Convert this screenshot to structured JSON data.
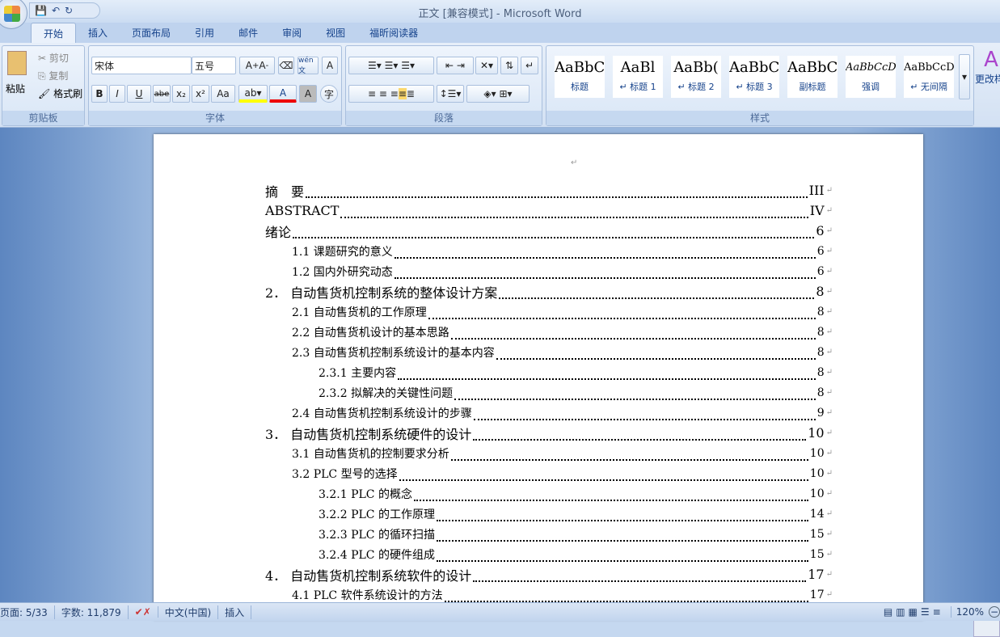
{
  "window": {
    "title": "正文 [兼容模式] - Microsoft Word"
  },
  "tabs": [
    "开始",
    "插入",
    "页面布局",
    "引用",
    "邮件",
    "审阅",
    "视图",
    "福昕阅读器"
  ],
  "clipboard": {
    "label": "剪贴板",
    "paste": "粘贴",
    "cut": "剪切",
    "copy": "复制",
    "format_painter": "格式刷"
  },
  "font": {
    "label": "字体",
    "font_name": "宋体",
    "font_size": "五号",
    "bold": "B",
    "italic": "I",
    "underline": "U",
    "strike": "abe",
    "sub": "x₂",
    "sup": "x²",
    "case": "Aa",
    "grow": "A",
    "shrink": "A",
    "color_letter": "A",
    "charshade": "A",
    "phonetic": "wén文",
    "border": "A",
    "circle": "字"
  },
  "paragraph": {
    "label": "段落"
  },
  "styles": {
    "label": "样式",
    "change": "更改样式",
    "items": [
      {
        "preview": "AaBbC",
        "name": "标题"
      },
      {
        "preview": "AaBl",
        "name": "↵ 标题 1"
      },
      {
        "preview": "AaBb(",
        "name": "↵ 标题 2"
      },
      {
        "preview": "AaBbC",
        "name": "↵ 标题 3"
      },
      {
        "preview": "AaBbC",
        "name": "副标题"
      },
      {
        "preview": "AaBbCcDc",
        "name": "强调"
      },
      {
        "preview": "AaBbCcDc",
        "name": "↵ 无间隔"
      }
    ]
  },
  "toc": [
    {
      "level": 0,
      "text": "摘　要",
      "page": "III"
    },
    {
      "level": 0,
      "text": "ABSTRACT",
      "page": "IV"
    },
    {
      "level": 0,
      "text": "绪论",
      "page": "6"
    },
    {
      "level": 1,
      "text": "1.1  课题研究的意义",
      "page": "6"
    },
    {
      "level": 1,
      "text": "1.2  国内外研究动态",
      "page": "6"
    },
    {
      "level": 0,
      "text": "2．  自动售货机控制系统的整体设计方案",
      "page": "8"
    },
    {
      "level": 1,
      "text": "2.1  自动售货机的工作原理",
      "page": "8"
    },
    {
      "level": 1,
      "text": "2.2  自动售货机设计的基本思路",
      "page": "8"
    },
    {
      "level": 1,
      "text": "2.3  自动售货机控制系统设计的基本内容",
      "page": "8"
    },
    {
      "level": 2,
      "text": "2.3.1  主要内容",
      "page": "8"
    },
    {
      "level": 2,
      "text": "2.3.2  拟解决的关键性问题",
      "page": "8"
    },
    {
      "level": 1,
      "text": "2.4  自动售货机控制系统设计的步骤",
      "page": "9"
    },
    {
      "level": 0,
      "text": "3．  自动售货机控制系统硬件的设计",
      "page": "10"
    },
    {
      "level": 1,
      "text": "3.1  自动售货机的控制要求分析",
      "page": "10"
    },
    {
      "level": 1,
      "text": "3.2 PLC 型号的选择",
      "page": "10"
    },
    {
      "level": 2,
      "text": "3.2.1 PLC 的概念",
      "page": "10"
    },
    {
      "level": 2,
      "text": "3.2.2 PLC 的工作原理",
      "page": "14"
    },
    {
      "level": 2,
      "text": "3.2.3 PLC 的循环扫描",
      "page": "15"
    },
    {
      "level": 2,
      "text": "3.2.4 PLC 的硬件组成",
      "page": "15"
    },
    {
      "level": 0,
      "text": "4．  自动售货机控制系统软件的设计",
      "page": "17"
    },
    {
      "level": 1,
      "text": "4.1 PLC 软件系统设计的方法",
      "page": "17"
    }
  ],
  "status": {
    "page": "页面: 5/33",
    "words": "字数: 11,879",
    "language": "中文(中国)",
    "mode": "插入",
    "zoom": "120%"
  },
  "marks": {
    "return": "↵"
  }
}
